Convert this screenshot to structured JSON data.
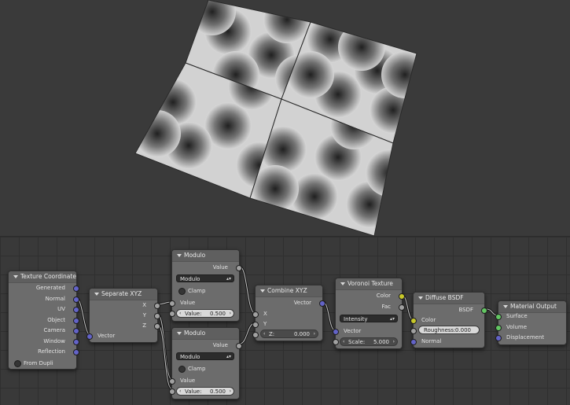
{
  "colors": {
    "vector_socket": "#6363c7",
    "value_socket": "#a1a1a1",
    "color_socket": "#c7c729",
    "shader_socket": "#63c763",
    "node_body": "#6c6c6c",
    "background": "#3a3a3a"
  },
  "nodes": {
    "texture_coordinate": {
      "title": "Texture Coordinate",
      "outputs": [
        "Generated",
        "Normal",
        "UV",
        "Object",
        "Camera",
        "Window",
        "Reflection"
      ],
      "from_dupli": "From Dupli"
    },
    "separate_xyz": {
      "title": "Separate XYZ",
      "outputs": [
        "X",
        "Y",
        "Z"
      ],
      "input": "Vector"
    },
    "modulo_1": {
      "title": "Modulo",
      "output": "Value",
      "operation": "Modulo",
      "clamp": "Clamp",
      "input_value": "Value",
      "value_label": "Value:",
      "value": "0.500"
    },
    "modulo_2": {
      "title": "Modulo",
      "output": "Value",
      "operation": "Modulo",
      "clamp": "Clamp",
      "input_value": "Value",
      "value_label": "Value:",
      "value": "0.500"
    },
    "combine_xyz": {
      "title": "Combine XYZ",
      "output": "Vector",
      "inputs": [
        "X",
        "Y"
      ],
      "z_label": "Z:",
      "z_value": "0.000"
    },
    "voronoi": {
      "title": "Voronoi Texture",
      "outputs": [
        "Color",
        "Fac"
      ],
      "coloring": "Intensity",
      "input": "Vector",
      "scale_label": "Scale:",
      "scale_value": "5.000"
    },
    "diffuse": {
      "title": "Diffuse BSDF",
      "output": "BSDF",
      "color": "Color",
      "roughness_label": "Roughness:",
      "roughness_value": "0.000",
      "normal": "Normal"
    },
    "output": {
      "title": "Material Output",
      "inputs": [
        "Surface",
        "Volume",
        "Displacement"
      ]
    }
  }
}
